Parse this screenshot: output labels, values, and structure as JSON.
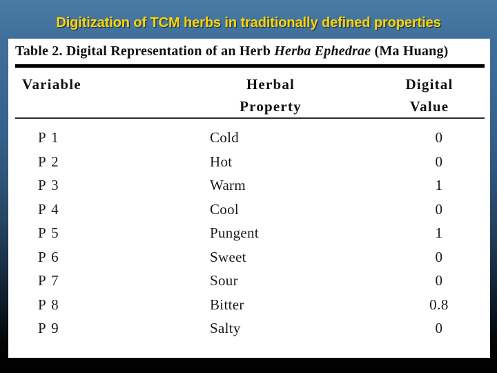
{
  "slide": {
    "title": "Digitization of TCM herbs in traditionally defined properties",
    "title_color": "#ffd300",
    "background_top_color": "#4a7ba6",
    "background_bottom_color": "#000000"
  },
  "table": {
    "caption_prefix": "Table 2. Digital Representation of an Herb ",
    "caption_italic": "Herba Ephedrae",
    "caption_suffix": " (Ma Huang)",
    "caption_full": "Table 2. Digital Representation of an Herb Herba Ephedrae (Ma Huang)",
    "headers": {
      "variable": "Variable",
      "herbal_line1": "Herbal",
      "herbal_line2": "Property",
      "digital_line1": "Digital",
      "digital_line2": "Value"
    },
    "rows": [
      {
        "variable": "P 1",
        "property": "Cold",
        "value": "0"
      },
      {
        "variable": "P 2",
        "property": "Hot",
        "value": "0"
      },
      {
        "variable": "P 3",
        "property": "Warm",
        "value": "1"
      },
      {
        "variable": "P 4",
        "property": "Cool",
        "value": "0"
      },
      {
        "variable": "P 5",
        "property": "Pungent",
        "value": "1"
      },
      {
        "variable": "P 6",
        "property": "Sweet",
        "value": "0"
      },
      {
        "variable": "P 7",
        "property": "Sour",
        "value": "0"
      },
      {
        "variable": "P 8",
        "property": "Bitter",
        "value": "0.8"
      },
      {
        "variable": "P 9",
        "property": "Salty",
        "value": "0"
      }
    ]
  }
}
